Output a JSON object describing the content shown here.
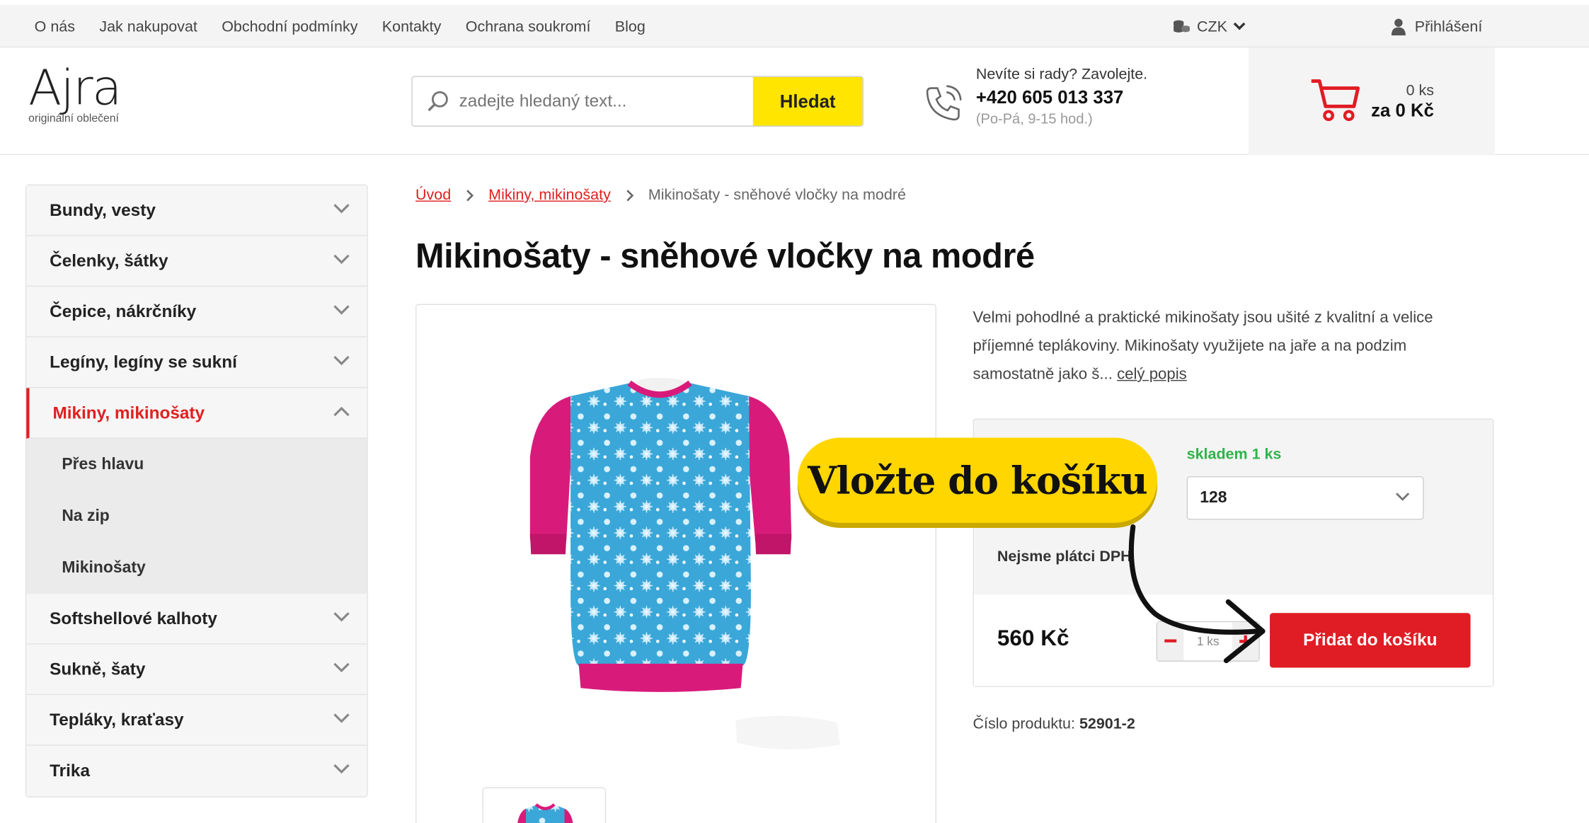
{
  "topbar": {
    "links": [
      "O nás",
      "Jak nakupovat",
      "Obchodní podmínky",
      "Kontakty",
      "Ochrana soukromí",
      "Blog"
    ],
    "currency": "CZK",
    "login": "Přihlášení"
  },
  "header": {
    "logo_word": "Ajra",
    "logo_sub": "originální oblečení",
    "search_placeholder": "zadejte hledaný text...",
    "search_button": "Hledat",
    "phone_question": "Nevíte si rady? Zavolejte.",
    "phone_number": "+420 605 013 337",
    "phone_hours": "(Po-Pá, 9-15 hod.)",
    "cart_count": "0 ks",
    "cart_total": "za 0 Kč"
  },
  "sidebar": {
    "categories_top": [
      "Bundy, vesty",
      "Čelenky, šátky",
      "Čepice, nákrčníky",
      "Legíny, legíny se sukní"
    ],
    "active_category": "Mikiny, mikinošaty",
    "subcategories": [
      "Přes hlavu",
      "Na zip",
      "Mikinošaty"
    ],
    "categories_bottom": [
      "Softshellové kalhoty",
      "Sukně, šaty",
      "Tepláky, kraťasy",
      "Trika"
    ]
  },
  "breadcrumb": {
    "home": "Úvod",
    "category": "Mikiny, mikinošaty",
    "current": "Mikinošaty - sněhové vločky na modré"
  },
  "product": {
    "title": "Mikinošaty - sněhové vločky na modré",
    "description": "Velmi pohodlné a praktické mikinošaty jsou ušité z kvalitní a velice příjemné teplákoviny.  Mikinošaty využijete na jaře a na podzim samostatně jako š...",
    "description_link": "celý popis",
    "stock": "skladem 1 ks",
    "variant": "128",
    "vat_note": "Nejsme plátci DPH",
    "price": "560 Kč",
    "qty": "1",
    "qty_unit": "ks",
    "add_to_cart": "Přidat do košíku",
    "product_number_label": "Číslo produktu:",
    "product_number": "52901-2"
  },
  "overlay": {
    "callout": "Vložte do košíku"
  },
  "colors": {
    "accent_red": "#e01c24",
    "search_yellow": "#ffe500",
    "callout_yellow": "#ffd600",
    "stock_green": "#2fb34a",
    "garment_pink": "#d81b7a",
    "garment_blue": "#3aa7d8"
  }
}
